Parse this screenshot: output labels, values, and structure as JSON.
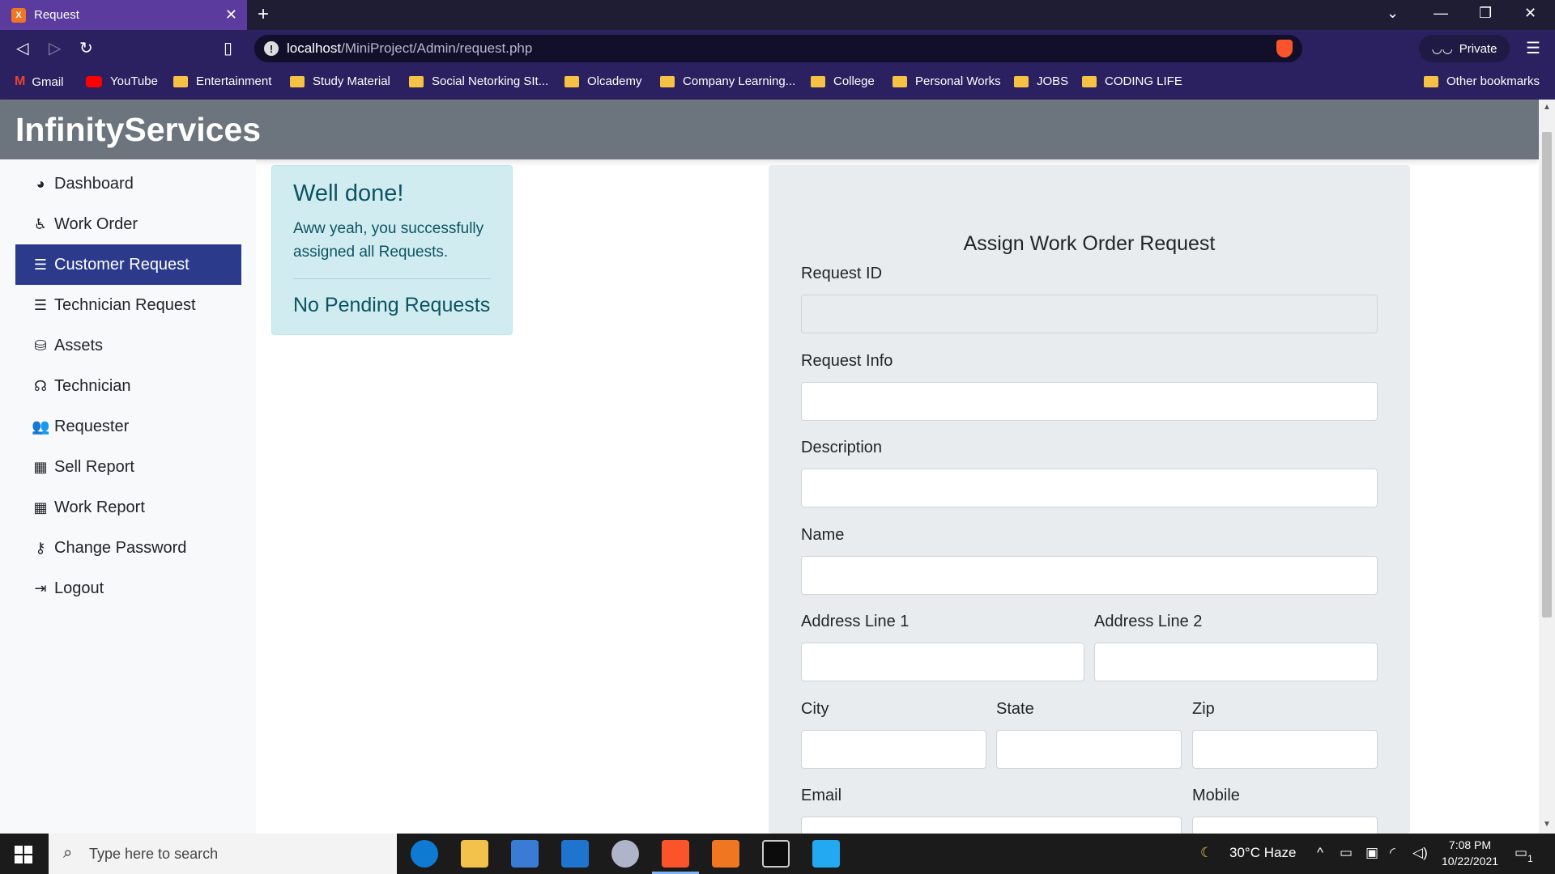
{
  "browser": {
    "tab_title": "Request",
    "tab_favicon": "X",
    "address_host": "localhost",
    "address_path": "/MiniProject/Admin/request.php",
    "private_label": "Private",
    "bookmarks": [
      {
        "label": "Gmail",
        "icon": "gmail-icon"
      },
      {
        "label": "YouTube",
        "icon": "youtube-icon"
      },
      {
        "label": "Entertainment",
        "icon": "folder-icon"
      },
      {
        "label": "Study Material",
        "icon": "folder-icon"
      },
      {
        "label": "Social Netorking SIt...",
        "icon": "folder-icon"
      },
      {
        "label": "Olcademy",
        "icon": "folder-icon"
      },
      {
        "label": "Company Learning...",
        "icon": "folder-icon"
      },
      {
        "label": "College",
        "icon": "folder-icon"
      },
      {
        "label": "Personal Works",
        "icon": "folder-icon"
      },
      {
        "label": "JOBS",
        "icon": "folder-icon"
      },
      {
        "label": "CODING LIFE",
        "icon": "folder-icon"
      }
    ],
    "other_bookmarks": "Other bookmarks"
  },
  "header": {
    "brand": "InfinityServices"
  },
  "sidebar": {
    "items": [
      {
        "label": "Dashboard",
        "icon": "tachometer-icon"
      },
      {
        "label": "Work Order",
        "icon": "wheelchair-icon"
      },
      {
        "label": "Customer Request",
        "icon": "align-center-icon"
      },
      {
        "label": "Technician Request",
        "icon": "align-center-icon"
      },
      {
        "label": "Assets",
        "icon": "database-icon"
      },
      {
        "label": "Technician",
        "icon": "headset-icon"
      },
      {
        "label": "Requester",
        "icon": "users-icon"
      },
      {
        "label": "Sell Report",
        "icon": "table-icon"
      },
      {
        "label": "Work Report",
        "icon": "table-icon"
      },
      {
        "label": "Change Password",
        "icon": "key-icon"
      },
      {
        "label": "Logout",
        "icon": "sign-out-icon"
      }
    ],
    "active_index": 2
  },
  "alert": {
    "heading": "Well done!",
    "message": "Aww yeah, you successfully assigned all Requests.",
    "footer": "No Pending Requests"
  },
  "form": {
    "title": "Assign Work Order Request",
    "labels": {
      "request_id": "Request ID",
      "request_info": "Request Info",
      "description": "Description",
      "name": "Name",
      "address1": "Address Line 1",
      "address2": "Address Line 2",
      "city": "City",
      "state": "State",
      "zip": "Zip",
      "email": "Email",
      "mobile": "Mobile"
    }
  },
  "taskbar": {
    "search_placeholder": "Type here to search",
    "weather": "30°C  Haze",
    "time": "7:08 PM",
    "date": "10/22/2021",
    "notification_count": "1"
  },
  "colors": {
    "header_bg": "#6c757d",
    "sidebar_active": "#2b3a8a",
    "alert_bg": "#d1ecf1",
    "alert_text": "#0c5460",
    "browser_purple": "#2b2060"
  }
}
